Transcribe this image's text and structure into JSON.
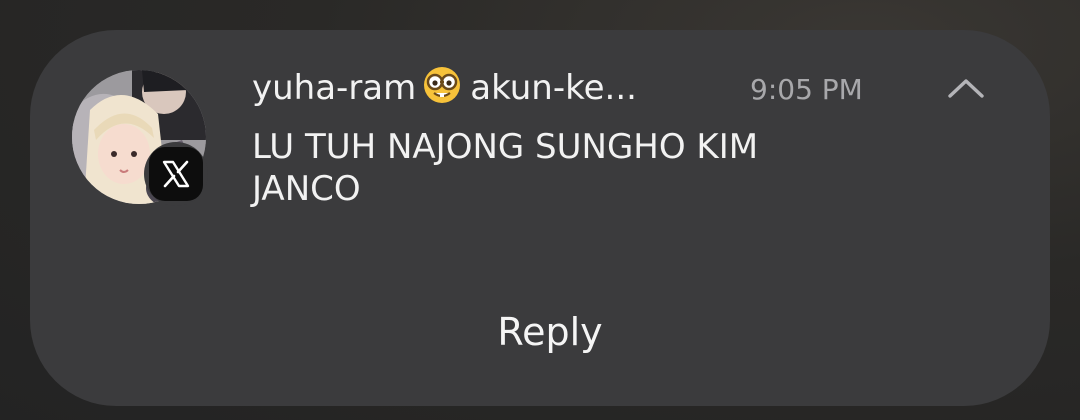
{
  "notification": {
    "app_icon": "x-logo-icon",
    "sender_part1": "yuha-ram",
    "sender_emoji": "nerd-face-emoji",
    "sender_part2": "akun-ke...",
    "time": "9:05 PM",
    "message": "LU TUH NAJONG SUNGHO KIM JANCO",
    "collapse_icon": "chevron-up-icon",
    "reply_label": "Reply"
  },
  "colors": {
    "card_background": "#3b3b3d",
    "text_primary": "#f2f2f2",
    "text_secondary": "#a8a8ab"
  }
}
